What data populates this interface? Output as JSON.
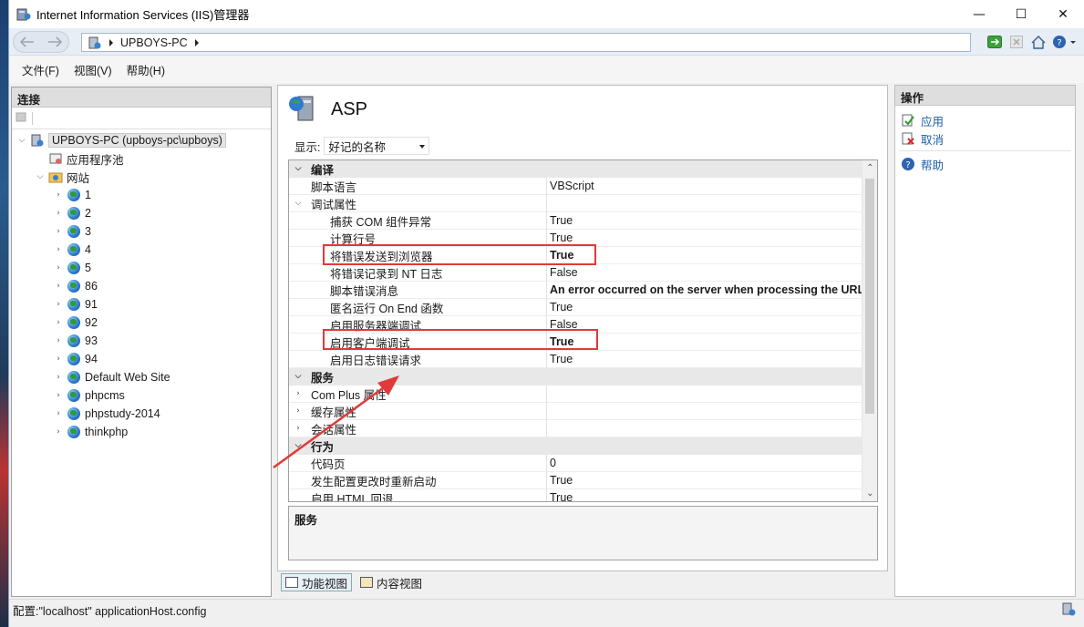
{
  "window": {
    "title": "Internet Information Services (IIS)管理器",
    "controls": {
      "minimize": "—",
      "maximize": "☐",
      "close": "✕"
    }
  },
  "address": {
    "back": "🡐",
    "forward": "🡒",
    "segments": [
      "UPBOYS-PC"
    ]
  },
  "menu": [
    "文件(F)",
    "视图(V)",
    "帮助(H)"
  ],
  "connections": {
    "header": "连接",
    "server": "UPBOYS-PC (upboys-pc\\upboys)",
    "app_pools": "应用程序池",
    "sites_label": "网站",
    "sites": [
      "1",
      "2",
      "3",
      "4",
      "5",
      "86",
      "91",
      "92",
      "93",
      "94",
      "Default Web Site",
      "phpcms",
      "phpstudy-2014",
      "thinkphp"
    ]
  },
  "center": {
    "title": "ASP",
    "show_label": "显示:",
    "show_value": "好记的名称",
    "rows": [
      {
        "type": "cat",
        "name": "编译"
      },
      {
        "type": "prop",
        "indent": 1,
        "name": "脚本语言",
        "value": "VBScript",
        "bold": false
      },
      {
        "type": "cat2",
        "name": "调试属性"
      },
      {
        "type": "prop",
        "indent": 2,
        "name": "捕获 COM 组件异常",
        "value": "True",
        "bold": false
      },
      {
        "type": "prop",
        "indent": 2,
        "name": "计算行号",
        "value": "True",
        "bold": false
      },
      {
        "type": "prop",
        "indent": 2,
        "name": "将错误发送到浏览器",
        "value": "True",
        "bold": true
      },
      {
        "type": "prop",
        "indent": 2,
        "name": "将错误记录到 NT 日志",
        "value": "False",
        "bold": false
      },
      {
        "type": "prop",
        "indent": 2,
        "name": "脚本错误消息",
        "value": "An error occurred on the server when processing the URL",
        "bold": true
      },
      {
        "type": "prop",
        "indent": 2,
        "name": "匿名运行 On End 函数",
        "value": "True",
        "bold": false
      },
      {
        "type": "prop",
        "indent": 2,
        "name": "启用服务器端调试",
        "value": "False",
        "bold": false
      },
      {
        "type": "prop",
        "indent": 2,
        "name": "启用客户端调试",
        "value": "True",
        "bold": true
      },
      {
        "type": "prop",
        "indent": 2,
        "name": "启用日志错误请求",
        "value": "True",
        "bold": false
      },
      {
        "type": "cat",
        "name": "服务"
      },
      {
        "type": "sub",
        "indent": 1,
        "name": "Com Plus 属性",
        "value": ""
      },
      {
        "type": "sub",
        "indent": 1,
        "name": "缓存属性",
        "value": ""
      },
      {
        "type": "sub",
        "indent": 1,
        "name": "会话属性",
        "value": ""
      },
      {
        "type": "cat",
        "name": "行为"
      },
      {
        "type": "prop",
        "indent": 1,
        "name": "代码页",
        "value": "0",
        "bold": false
      },
      {
        "type": "prop",
        "indent": 1,
        "name": "发生配置更改时重新启动",
        "value": "True",
        "bold": false
      },
      {
        "type": "prop",
        "indent": 1,
        "name": "启用 HTML 回退",
        "value": "True",
        "bold": false
      }
    ],
    "description": "服务",
    "tabs": [
      "功能视图",
      "内容视图"
    ]
  },
  "actions": {
    "header": "操作",
    "items": [
      "应用",
      "取消",
      "帮助"
    ]
  },
  "status": "配置:\"localhost\" applicationHost.config",
  "colors": {
    "annotation": "#e03a3a",
    "link": "#1c5fa8"
  }
}
